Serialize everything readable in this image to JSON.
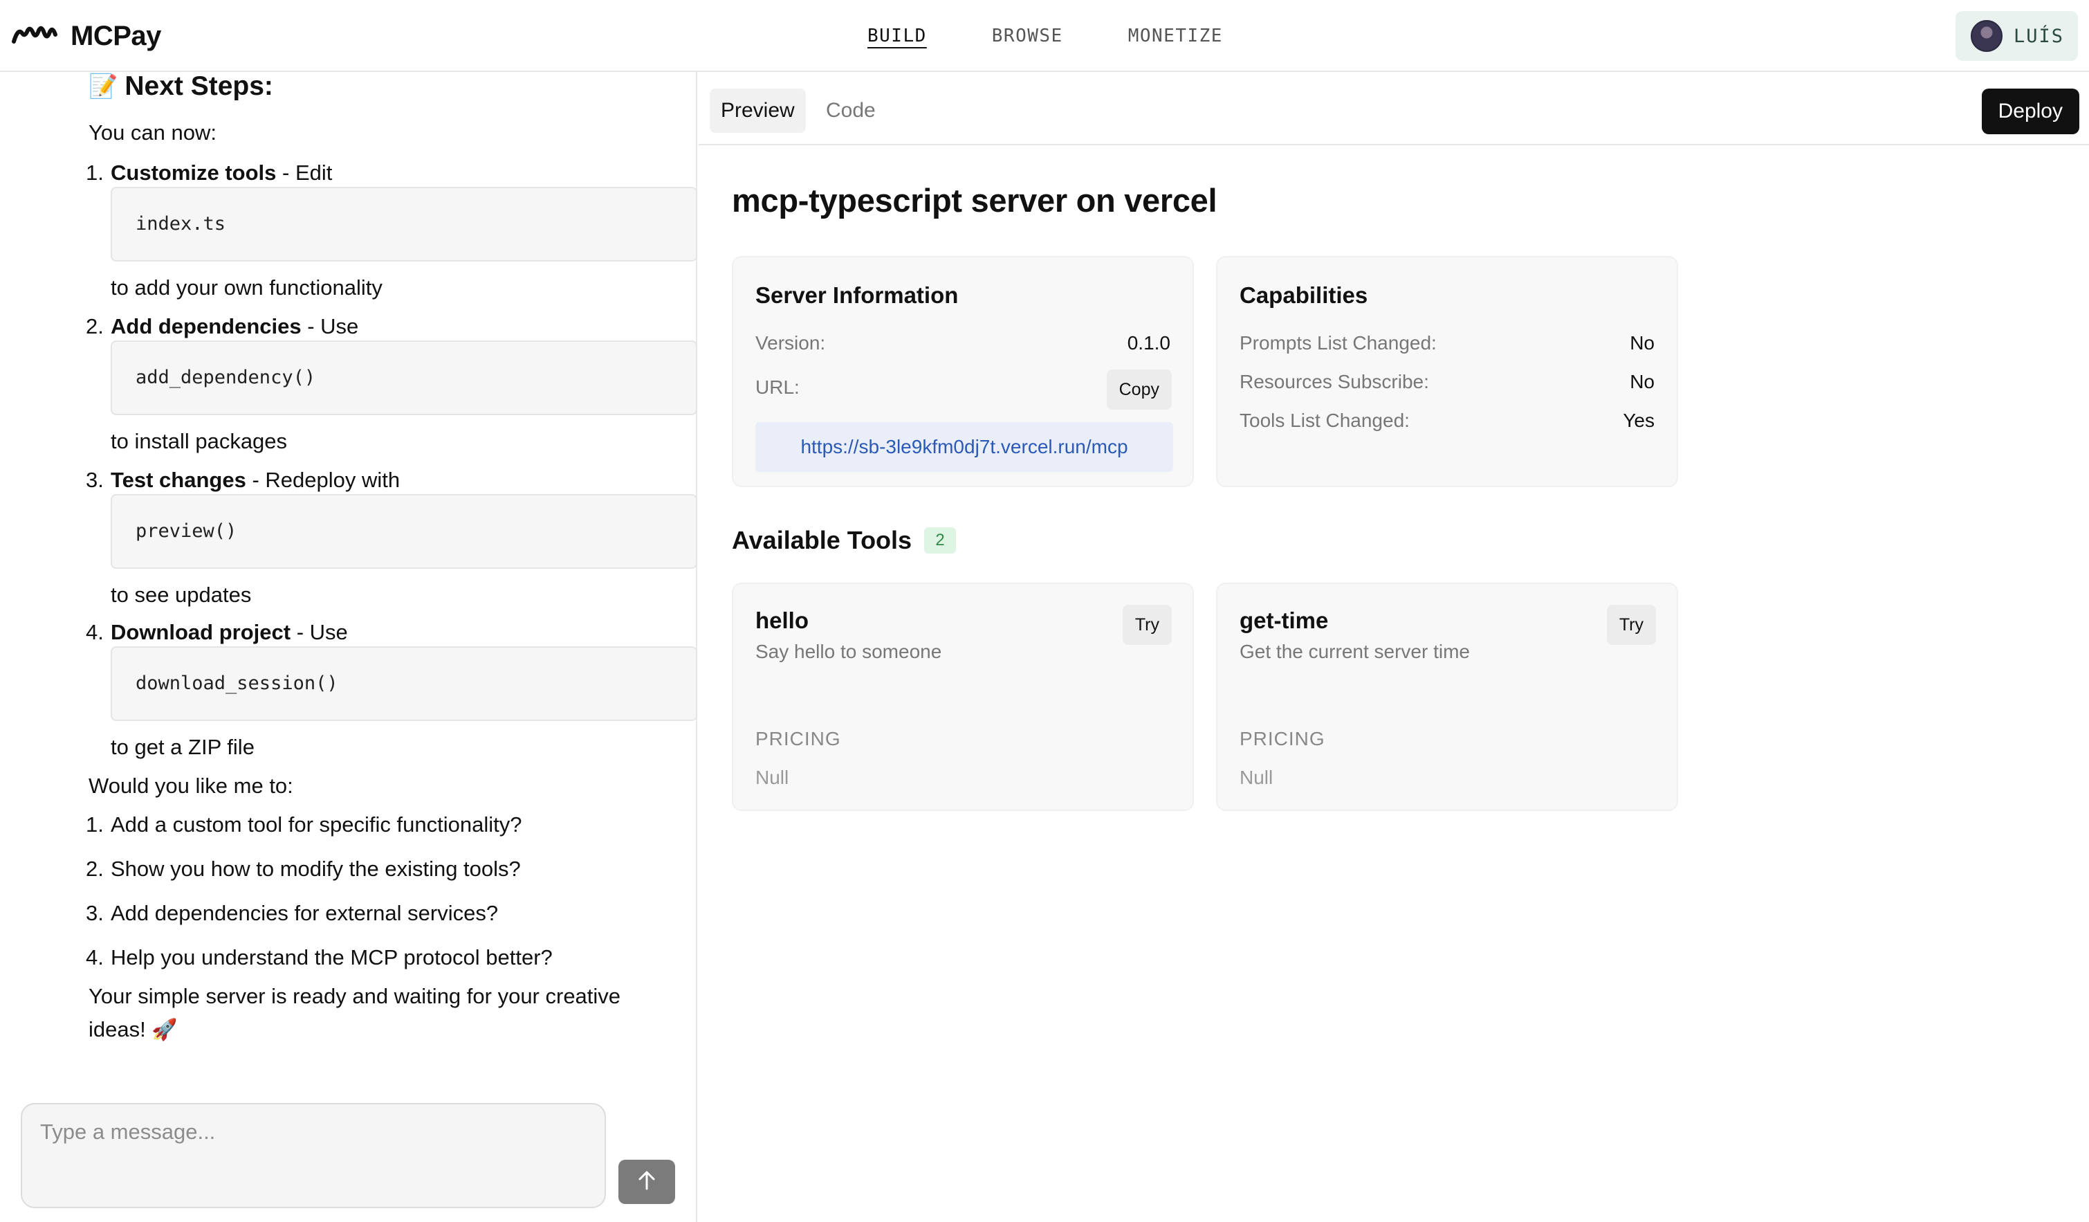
{
  "header": {
    "brand": "MCPay",
    "nav": [
      {
        "label": "BUILD",
        "active": true
      },
      {
        "label": "BROWSE",
        "active": false
      },
      {
        "label": "MONETIZE",
        "active": false
      }
    ],
    "user": {
      "name": "LUÍS"
    }
  },
  "chat": {
    "heading_emoji": "📝",
    "heading": "Next Steps:",
    "intro": "You can now:",
    "steps": [
      {
        "num": "1.",
        "title": "Customize tools",
        "verb": " - Edit",
        "code": "index.ts",
        "after": "to add your own functionality"
      },
      {
        "num": "2.",
        "title": "Add dependencies",
        "verb": " - Use",
        "code": "add_dependency()",
        "after": "to install packages"
      },
      {
        "num": "3.",
        "title": "Test changes",
        "verb": " - Redeploy with",
        "code": "preview()",
        "after": "to see updates"
      },
      {
        "num": "4.",
        "title": "Download project",
        "verb": " - Use",
        "code": "download_session()",
        "after": "to get a ZIP file"
      }
    ],
    "question": "Would you like me to:",
    "options": [
      {
        "num": "1.",
        "text": "Add a custom tool for specific functionality?"
      },
      {
        "num": "2.",
        "text": "Show you how to modify the existing tools?"
      },
      {
        "num": "3.",
        "text": "Add dependencies for external services?"
      },
      {
        "num": "4.",
        "text": "Help you understand the MCP protocol better?"
      }
    ],
    "closing_line1": "Your simple server is ready and waiting for your creative",
    "closing_line2": "ideas!",
    "closing_emoji": "🚀",
    "input_placeholder": "Type a message..."
  },
  "preview": {
    "tabs": [
      {
        "label": "Preview",
        "active": true
      },
      {
        "label": "Code",
        "active": false
      }
    ],
    "deploy_label": "Deploy",
    "title": "mcp-typescript server on vercel",
    "server_info": {
      "heading": "Server Information",
      "version_label": "Version:",
      "version": "0.1.0",
      "url_label": "URL:",
      "copy_label": "Copy",
      "url": "https://sb-3le9kfm0dj7t.vercel.run/mcp"
    },
    "capabilities": {
      "heading": "Capabilities",
      "items": [
        {
          "label": "Prompts List Changed:",
          "value": "No"
        },
        {
          "label": "Resources Subscribe:",
          "value": "No"
        },
        {
          "label": "Tools List Changed:",
          "value": "Yes"
        }
      ]
    },
    "tools_heading": "Available Tools",
    "tools_count": "2",
    "tools": [
      {
        "name": "hello",
        "description": "Say hello to someone",
        "try_label": "Try",
        "pricing_label": "PRICING",
        "pricing": "Null"
      },
      {
        "name": "get-time",
        "description": "Get the current server time",
        "try_label": "Try",
        "pricing_label": "PRICING",
        "pricing": "Null"
      }
    ]
  },
  "colors": {
    "accent_green_bg": "#dff5e4",
    "url_blue": "#2b59b8",
    "deploy_bg": "#111111"
  }
}
